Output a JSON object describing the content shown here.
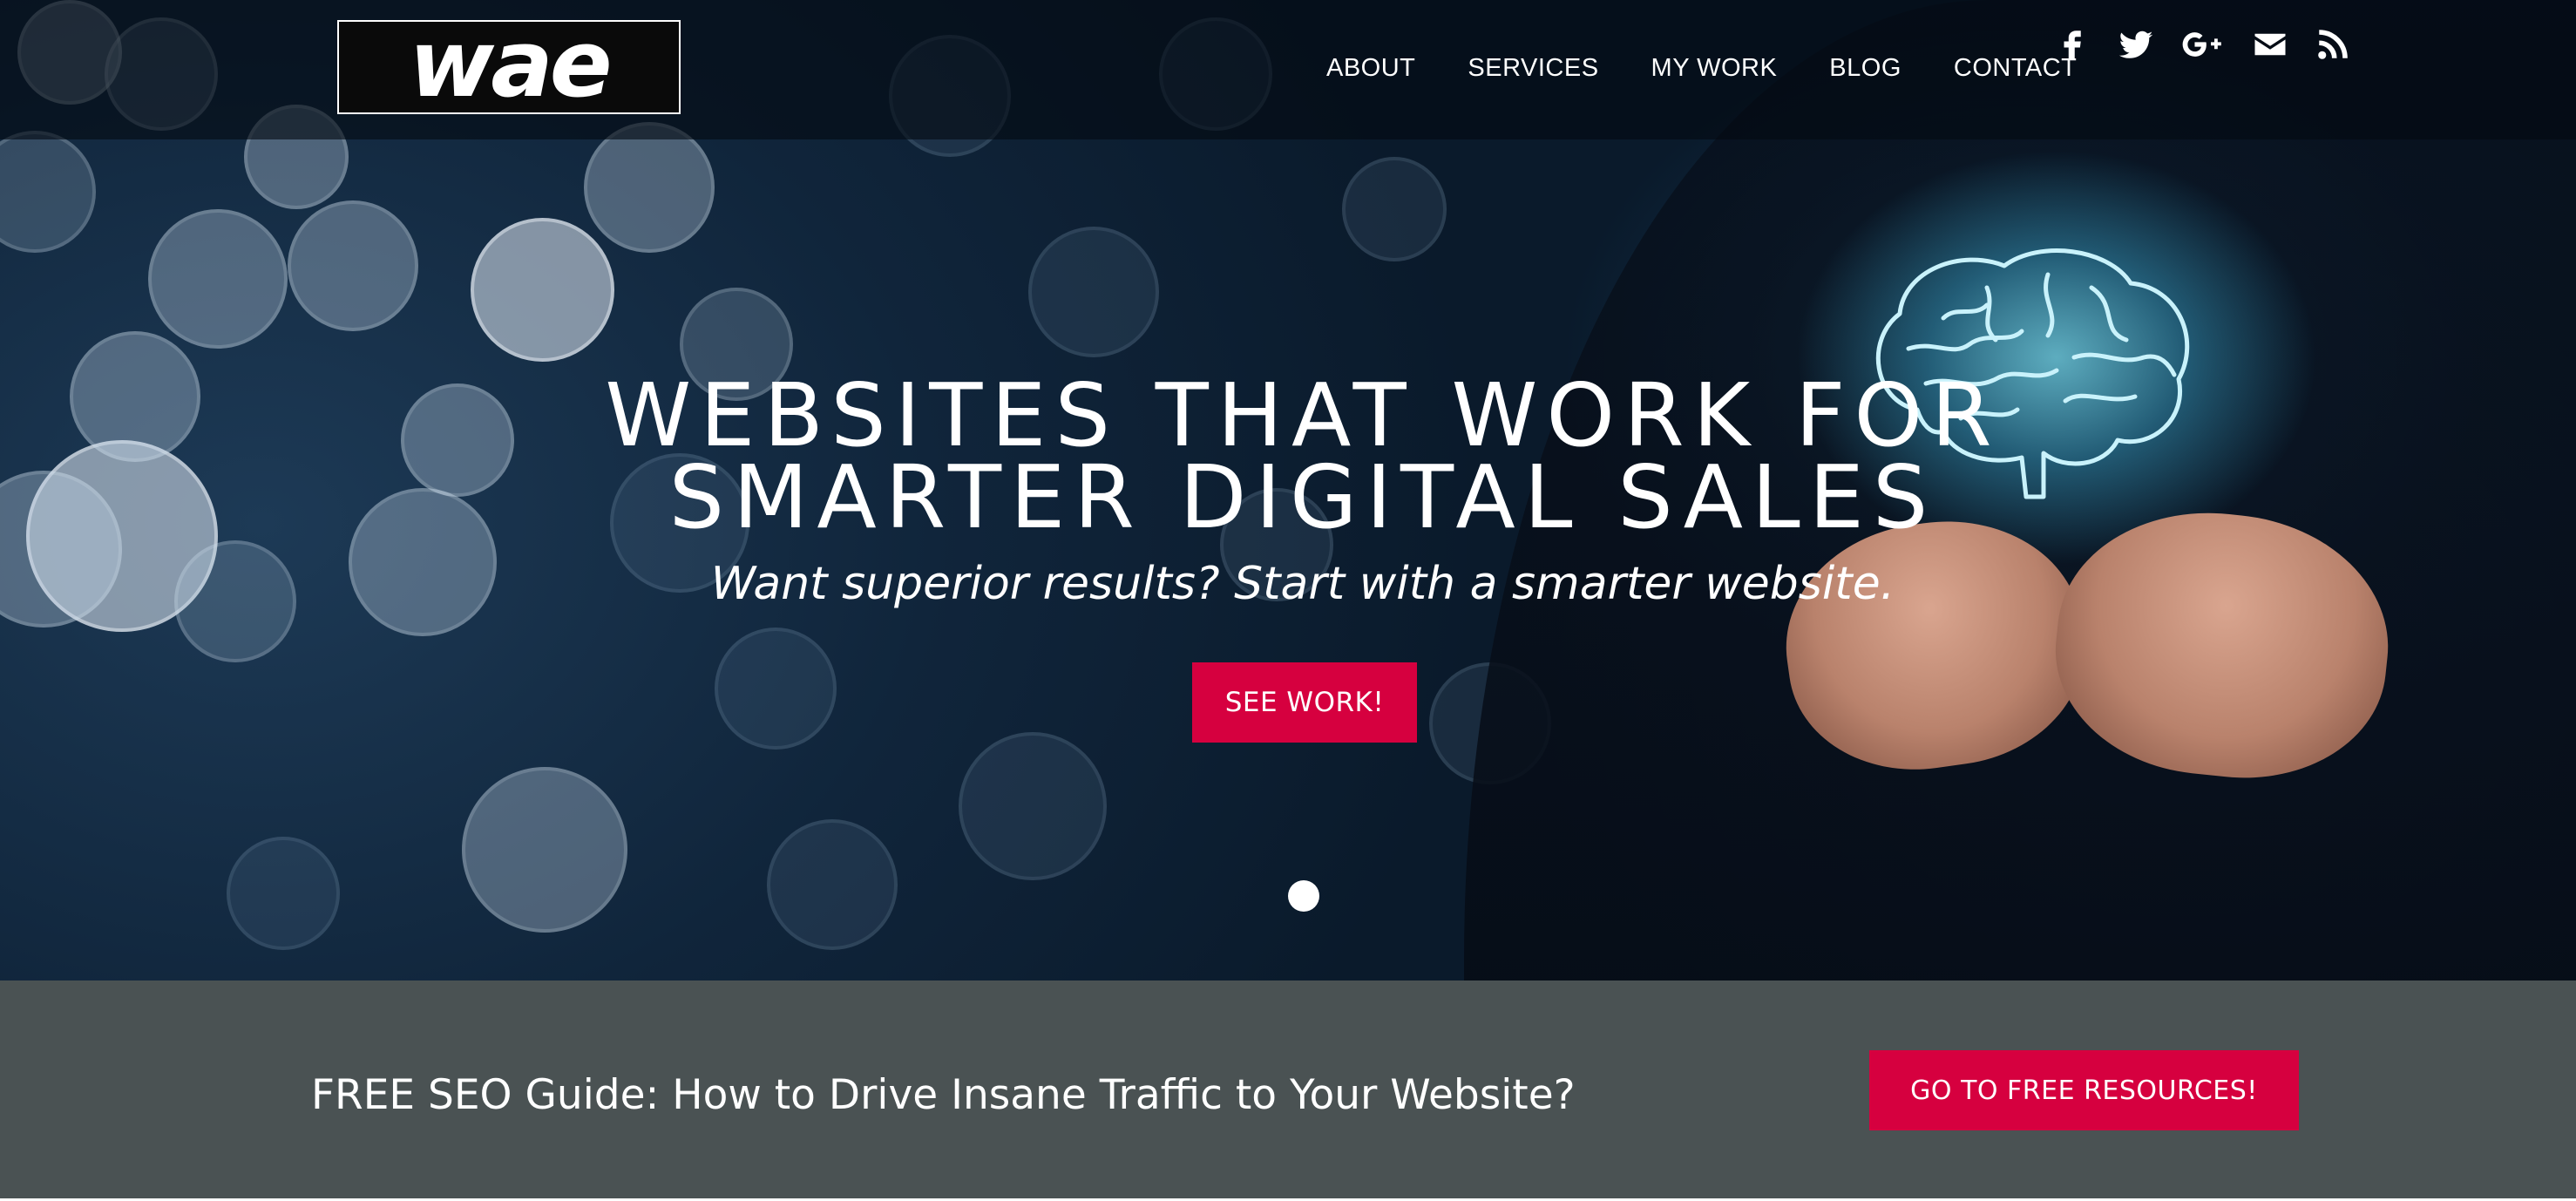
{
  "header": {
    "logo_text": "wae",
    "nav": [
      {
        "label": "ABOUT"
      },
      {
        "label": "SERVICES"
      },
      {
        "label": "MY WORK"
      },
      {
        "label": "BLOG"
      },
      {
        "label": "CONTACT"
      }
    ],
    "social_icons": [
      "facebook-icon",
      "twitter-icon",
      "google-plus-icon",
      "email-icon",
      "rss-icon"
    ]
  },
  "hero": {
    "title_line1": "WEBSITES THAT WORK FOR",
    "title_line2": "SMARTER DIGITAL SALES",
    "subtitle": "Want superior results? Start with a smarter website.",
    "cta_label": "SEE WORK!",
    "slides_total": 1,
    "active_slide": 1
  },
  "promo": {
    "text": "FREE SEO Guide: How to Drive Insane Traffic to Your Website?",
    "button_label": "GO TO FREE RESOURCES!"
  },
  "colors": {
    "accent": "#d6003f",
    "promo_bg": "#4a5253",
    "header_bg": "#030a12",
    "hero_bg": "#10253b"
  }
}
